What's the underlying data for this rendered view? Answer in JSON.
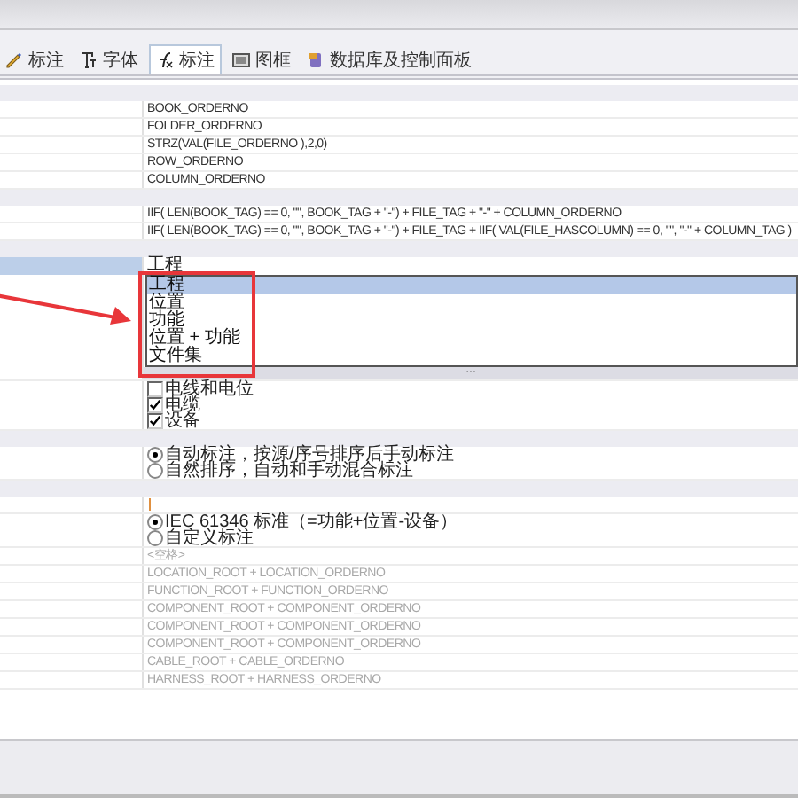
{
  "tabs": [
    {
      "label": "标注",
      "selected": false
    },
    {
      "label": "字体",
      "selected": false
    },
    {
      "label": "标注",
      "selected": true
    },
    {
      "label": "图框",
      "selected": false
    },
    {
      "label": "数据库及控制面板",
      "selected": false
    }
  ],
  "grid": [
    {
      "kind": "header"
    },
    {
      "kind": "text",
      "value": "BOOK_ORDERNO"
    },
    {
      "kind": "text",
      "value": "FOLDER_ORDERNO"
    },
    {
      "kind": "text",
      "value": "STRZ(VAL(FILE_ORDERNO ),2,0)"
    },
    {
      "kind": "text",
      "value": "ROW_ORDERNO"
    },
    {
      "kind": "text",
      "value": "COLUMN_ORDERNO"
    },
    {
      "kind": "header"
    },
    {
      "kind": "text",
      "value": "IIF( LEN(BOOK_TAG) == 0, \"\", BOOK_TAG + \"-\") + FILE_TAG + \"-\" + COLUMN_ORDERNO"
    },
    {
      "kind": "text",
      "value": "IIF( LEN(BOOK_TAG) == 0, \"\", BOOK_TAG + \"-\") + FILE_TAG + IIF( VAL(FILE_HASCOLUMN) == 0, \"\", \"-\" + COLUMN_TAG )"
    },
    {
      "kind": "header"
    },
    {
      "kind": "combo",
      "selected": true,
      "value": "工程",
      "handle": "...",
      "options": [
        {
          "label": "工程",
          "selected": true
        },
        {
          "label": "位置",
          "selected": false
        },
        {
          "label": "功能",
          "selected": false
        },
        {
          "label": "位置 + 功能",
          "selected": false
        },
        {
          "label": "文件集",
          "selected": false
        }
      ]
    },
    {
      "kind": "checks",
      "items": [
        {
          "label": "电线和电位",
          "checked": false
        },
        {
          "label": "电缆",
          "checked": true
        },
        {
          "label": "设备",
          "checked": true
        }
      ]
    },
    {
      "kind": "header"
    },
    {
      "kind": "radios",
      "items": [
        {
          "label": "自动标注，按源/序号排序后手动标注",
          "selected": true
        },
        {
          "label": "自然排序，自动和手动混合标注",
          "selected": false
        }
      ]
    },
    {
      "kind": "header"
    },
    {
      "kind": "input"
    },
    {
      "kind": "radios",
      "items": [
        {
          "label": "IEC 61346 标准（=功能+位置-设备）",
          "selected": true
        },
        {
          "label": "自定义标注",
          "selected": false
        }
      ]
    },
    {
      "kind": "muted",
      "value": "<空格>"
    },
    {
      "kind": "muted",
      "value": "LOCATION_ROOT + LOCATION_ORDERNO"
    },
    {
      "kind": "muted",
      "value": "FUNCTION_ROOT + FUNCTION_ORDERNO"
    },
    {
      "kind": "muted",
      "value": "COMPONENT_ROOT + COMPONENT_ORDERNO"
    },
    {
      "kind": "muted",
      "value": "COMPONENT_ROOT + COMPONENT_ORDERNO"
    },
    {
      "kind": "muted",
      "value": "COMPONENT_ROOT + COMPONENT_ORDERNO"
    },
    {
      "kind": "muted",
      "value": "CABLE_ROOT + CABLE_ORDERNO"
    },
    {
      "kind": "muted",
      "value": "HARNESS_ROOT + HARNESS_ORDERNO"
    }
  ]
}
